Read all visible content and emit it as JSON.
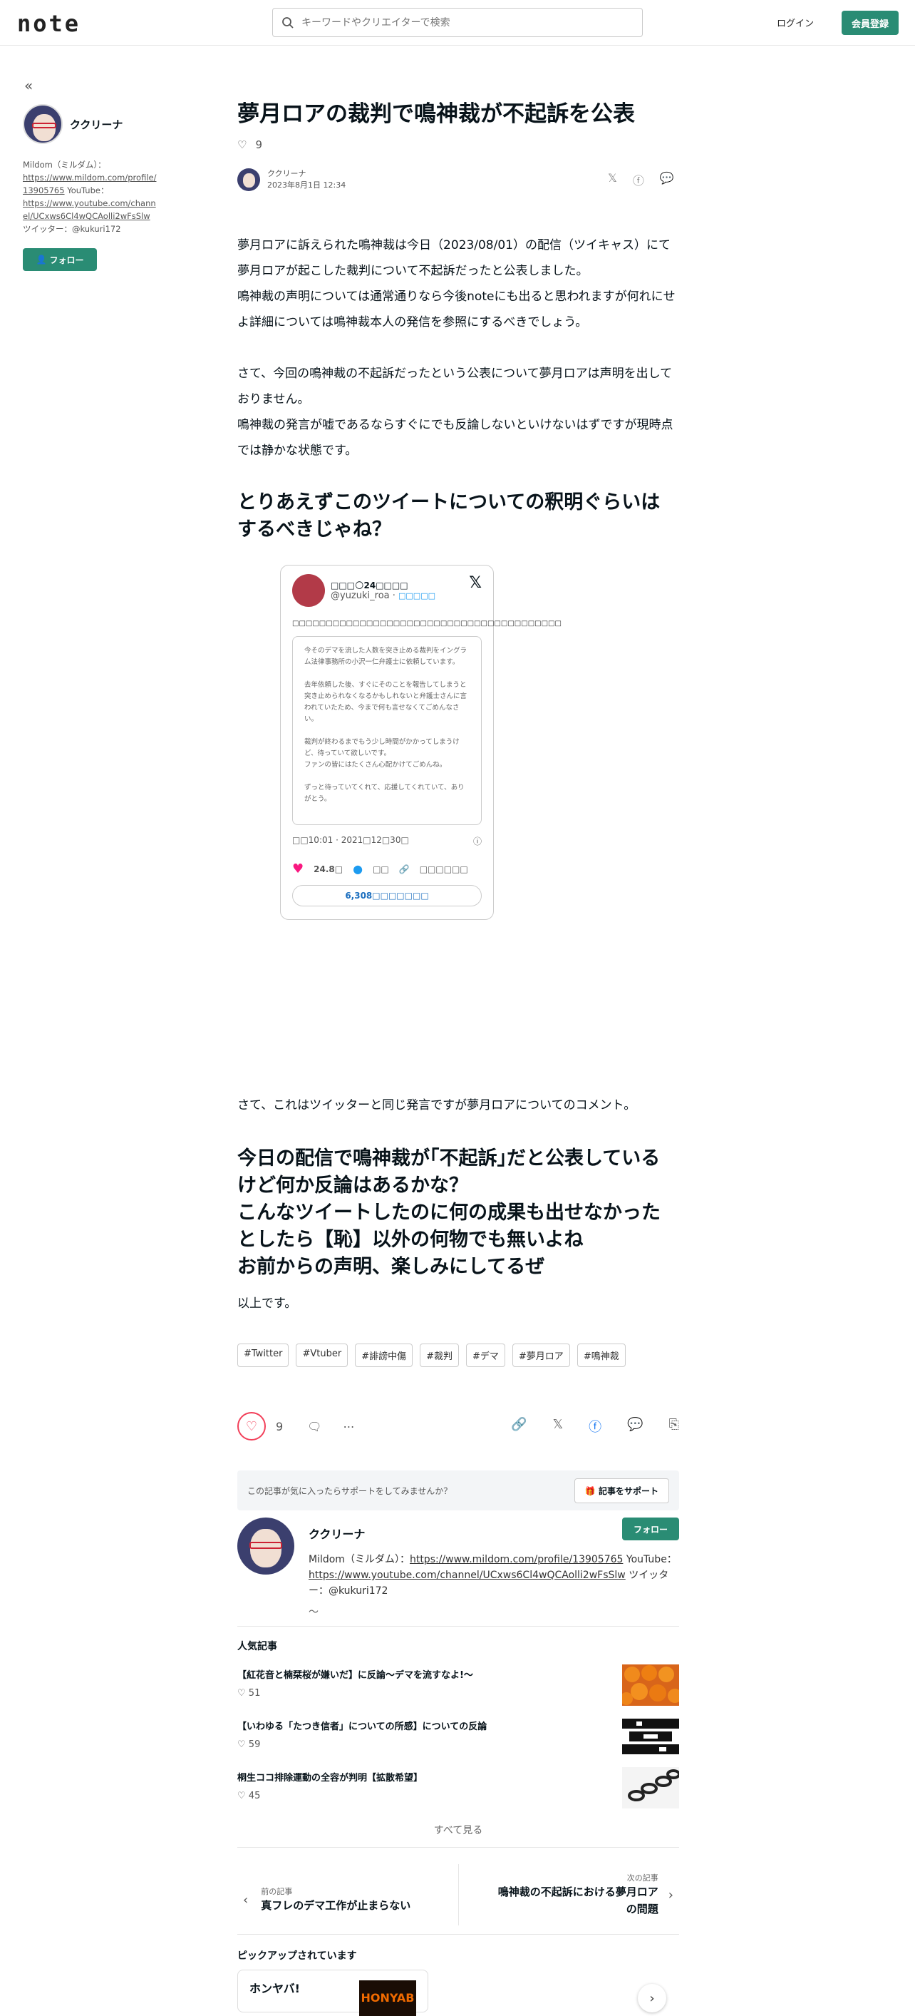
{
  "header": {
    "logo": "note",
    "search_placeholder": "キーワードやクリエイターで検索",
    "login": "ログイン",
    "register": "会員登録"
  },
  "sidebar": {
    "collapse_icon": "«",
    "author_name": "ククリーナ",
    "bio_prefix": "Mildom（ミルダム）：",
    "bio_link1": "https://www.mildom.com/profile/13905765",
    "bio_mid": " YouTube：",
    "bio_link2": "https://www.youtube.com/channel/UCxws6Cl4wQCAolli2wFsSlw",
    "bio_suffix": " ツイッター：@kukuri172",
    "follow": "フォロー"
  },
  "article": {
    "title": "夢月ロアの裁判で鳴神裁が不起訴を公表",
    "like_count": "9",
    "author": "ククリーナ",
    "date": "2023年8月1日 12:34",
    "p1": "夢月ロアに訴えられた鳴神裁は今日（2023/08/01）の配信（ツイキャス）にて夢月ロアが起こした裁判について不起訴だったと公表しました。",
    "p2": "鳴神裁の声明については通常通りなら今後noteにも出ると思われますが何れにせよ詳細については鳴神裁本人の発信を参照にするべきでしょう。",
    "p3": "さて、今回の鳴神裁の不起訴だったという公表について夢月ロアは声明を出しておりません。",
    "p4": "鳴神裁の発言が嘘であるならすぐにでも反論しないといけないはずですが現時点では静かな状態です。",
    "h2a": "とりあえずこのツイートについての釈明ぐらいはするべきじゃね？",
    "p5": "さて、これはツイッターと同じ発言ですが夢月ロアについてのコメント。",
    "h2b_l1": "今日の配信で鳴神裁が｢不起訴｣だと公表しているけど何か反論はあるかな？",
    "h2b_l2": "こんなツイートしたのに何の成果も出せなかったとしたら【恥】以外の何物でも無いよね",
    "h2b_l3": "お前からの声明、楽しみにしてるぜ",
    "p6": "以上です。",
    "tags": [
      "#Twitter",
      "#Vtuber",
      "#誹謗中傷",
      "#裁判",
      "#デマ",
      "#夢月ロア",
      "#鳴神裁"
    ]
  },
  "tweet": {
    "name": "□□□🌕24□□□□",
    "handle": "@yuzuki_roa · ",
    "follow": "□□□□□",
    "text": "□□□□□□□□□□□□□□□□□□□□□□□□□□□□□□□□□□□□□□□□",
    "quote": "今そのデマを流した人数を突き止める裁判をイングラム法律事務所の小沢一仁弁護士に依頼しています。\n\n去年依頼した後、すぐにそのことを報告してしまうと突き止められなくなるかもしれないと弁護士さんに言われていたため、今まで何も言せなくてごめんなさい。\n\n裁判が終わるまでもう少し時間がかかってしまうけど、待っていて欲しいです。\nファンの皆にはたくさん心配かけてごめんね。\n\nずっと待っていてくれて、応援してくれていて、ありがとう。",
    "time": "□□10:01 · 2021□12□30□",
    "likes": "24.8□",
    "reply": "□□",
    "copy": "□□□□□□",
    "replies_btn": "6,308□□□□□□□"
  },
  "actions": {
    "like_count": "9"
  },
  "support": {
    "prompt": "この記事が気に入ったらサポートをしてみませんか？",
    "button": "記事をサポート"
  },
  "profile": {
    "name": "ククリーナ",
    "follow": "フォロー",
    "bio_prefix": "Mildom（ミルダム）：",
    "bio_link1": "https://www.mildom.com/profile/13905765",
    "bio_mid": " YouTube：",
    "bio_link2": "https://www.youtube.com/channel/UCxws6Cl4wQCAolli2wFsSlw",
    "bio_suffix": " ツイッター：@kukuri172"
  },
  "popular": {
    "heading": "人気記事",
    "items": [
      {
        "title": "【紅花音と楠栞桜が嫌いだ】に反論～デマを流すなよ!～",
        "likes": "51"
      },
      {
        "title": "【いわゆる「たつき信者」についての所感】についての反論",
        "likes": "59"
      },
      {
        "title": "桐生ココ排除運動の全容が判明【拡散希望】",
        "likes": "45"
      }
    ],
    "see_all": "すべて見る"
  },
  "nav": {
    "prev_label": "前の記事",
    "prev_title": "真フレのデマ工作が止まらない",
    "next_label": "次の記事",
    "next_title_l1": "鳴神裁の不起訴における夢月ロア",
    "next_title_l2": "の問題"
  },
  "pickup": {
    "heading": "ピックアップされています",
    "card_title": "ホンヤバ!",
    "thumb_text": "HONYAB"
  }
}
